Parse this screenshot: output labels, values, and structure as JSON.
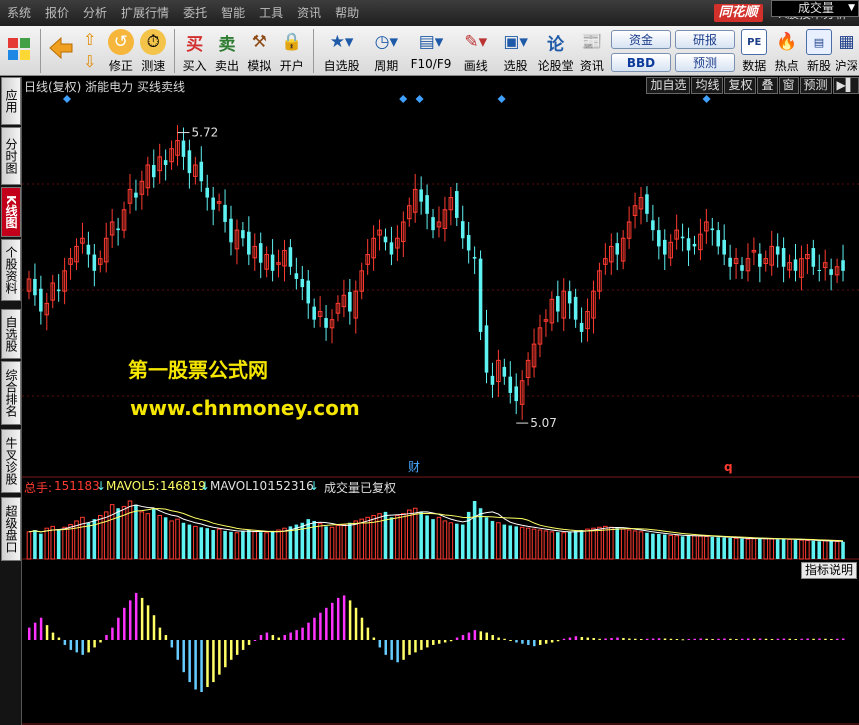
{
  "menu": [
    "系统",
    "报价",
    "分析",
    "扩展行情",
    "委托",
    "智能",
    "工具",
    "资讯",
    "帮助"
  ],
  "brand": {
    "logo": "同花顺",
    "title": "- A股技术分析"
  },
  "toolbar": {
    "modify": "修正",
    "test": "测速",
    "buy": "买入",
    "sell": "卖出",
    "simulate": "模拟",
    "open": "开户",
    "watchlist": "自选股",
    "period": "周期",
    "f10": "F10/F9",
    "draw": "画线",
    "select": "选股",
    "forum": "论股堂",
    "news": "资讯",
    "fund": "资金",
    "research": "研报",
    "bbd": "BBD",
    "predict": "预测",
    "data": "数据",
    "hot": "热点",
    "newstock": "新股",
    "sh": "沪深"
  },
  "sidetabs": [
    {
      "label": "应用"
    },
    {
      "label": "分时图"
    },
    {
      "label": "K线图",
      "active": true
    },
    {
      "label": "个股资料"
    },
    {
      "label": "自选股"
    },
    {
      "label": "综合排名"
    },
    {
      "label": "牛叉诊股"
    },
    {
      "label": "超级盘口"
    }
  ],
  "chart_header": {
    "title": "日线(复权)  浙能电力  买线卖线",
    "buttons": [
      "加自选",
      "均线",
      "复权",
      "叠",
      "窗",
      "预测",
      "▶▌"
    ]
  },
  "price": {
    "high_label": "5.72",
    "low_label": "5.07",
    "marker_cai": "财",
    "marker_q": "q",
    "ymin": 4.95,
    "ymax": 5.8
  },
  "volume_header": {
    "total_label": "总手:",
    "total": "151183",
    "ma5_label": "MAVOL5:",
    "ma5": "146819",
    "ma10_label": "MAVOL10:",
    "ma10": "152316",
    "note": "成交量已复权",
    "dropdown": "成交量"
  },
  "explain_button": "指标说明",
  "watermark": {
    "line1": "第一股票公式网",
    "line2": "www.chnmoney.com"
  },
  "colors": {
    "up": "#ff3b30",
    "down": "#5ff2f2",
    "ma": "#ffffff",
    "macd_pos_strong": "#ff33ff",
    "macd_pos": "#ffff66",
    "macd_neg": "#66ccff",
    "macd_neg2": "#ffff66"
  },
  "chart_data": {
    "type": "candlestick",
    "closes": [
      5.38,
      5.34,
      5.3,
      5.32,
      5.37,
      5.35,
      5.4,
      5.43,
      5.46,
      5.48,
      5.44,
      5.4,
      5.43,
      5.48,
      5.52,
      5.5,
      5.55,
      5.6,
      5.58,
      5.62,
      5.66,
      5.63,
      5.68,
      5.66,
      5.7,
      5.72,
      5.68,
      5.64,
      5.66,
      5.62,
      5.58,
      5.55,
      5.57,
      5.52,
      5.47,
      5.5,
      5.48,
      5.44,
      5.46,
      5.42,
      5.44,
      5.4,
      5.42,
      5.45,
      5.41,
      5.38,
      5.36,
      5.32,
      5.28,
      5.3,
      5.26,
      5.28,
      5.32,
      5.34,
      5.3,
      5.35,
      5.4,
      5.44,
      5.48,
      5.5,
      5.47,
      5.44,
      5.48,
      5.52,
      5.56,
      5.6,
      5.57,
      5.54,
      5.5,
      5.52,
      5.55,
      5.58,
      5.53,
      5.48,
      5.45,
      5.43,
      5.25,
      5.15,
      5.12,
      5.18,
      5.14,
      5.1,
      5.08,
      5.13,
      5.18,
      5.22,
      5.26,
      5.28,
      5.33,
      5.3,
      5.35,
      5.32,
      5.28,
      5.25,
      5.3,
      5.35,
      5.4,
      5.43,
      5.46,
      5.44,
      5.48,
      5.52,
      5.56,
      5.58,
      5.54,
      5.5,
      5.46,
      5.44,
      5.47,
      5.5,
      5.48,
      5.45,
      5.46,
      5.49,
      5.52,
      5.5,
      5.46,
      5.44,
      5.41,
      5.43,
      5.4,
      5.43,
      5.45,
      5.41,
      5.43,
      5.46,
      5.44,
      5.41,
      5.42,
      5.4,
      5.43,
      5.44,
      5.41,
      5.4,
      5.42,
      5.39,
      5.41,
      5.4
    ],
    "volumes": [
      150,
      160,
      140,
      170,
      180,
      165,
      175,
      190,
      210,
      230,
      200,
      220,
      240,
      260,
      300,
      280,
      290,
      320,
      300,
      260,
      250,
      280,
      240,
      230,
      210,
      220,
      200,
      190,
      180,
      175,
      170,
      160,
      165,
      155,
      150,
      145,
      155,
      160,
      150,
      148,
      145,
      150,
      160,
      170,
      180,
      190,
      200,
      220,
      210,
      195,
      180,
      175,
      185,
      190,
      200,
      210,
      220,
      230,
      240,
      250,
      260,
      230,
      240,
      250,
      270,
      280,
      260,
      240,
      220,
      230,
      210,
      200,
      195,
      190,
      260,
      320,
      280,
      230,
      210,
      200,
      190,
      185,
      180,
      175,
      170,
      165,
      160,
      155,
      150,
      148,
      145,
      150,
      155,
      160,
      165,
      170,
      175,
      180,
      175,
      170,
      165,
      160,
      155,
      150,
      145,
      140,
      138,
      135,
      130,
      128,
      125,
      130,
      128,
      126,
      124,
      122,
      120,
      118,
      116,
      114,
      112,
      110,
      112,
      114,
      112,
      110,
      108,
      110,
      108,
      106,
      104,
      102,
      100,
      98,
      100,
      98,
      96,
      95
    ],
    "macd": [
      0.5,
      0.7,
      0.9,
      0.6,
      0.3,
      0.1,
      -0.2,
      -0.4,
      -0.5,
      -0.6,
      -0.5,
      -0.3,
      -0.1,
      0.2,
      0.5,
      0.9,
      1.3,
      1.6,
      1.9,
      1.7,
      1.4,
      1.0,
      0.5,
      0.2,
      -0.3,
      -0.8,
      -1.3,
      -1.7,
      -2.0,
      -2.1,
      -1.9,
      -1.7,
      -1.4,
      -1.1,
      -0.8,
      -0.6,
      -0.4,
      -0.2,
      0.0,
      0.2,
      0.3,
      0.2,
      0.1,
      0.2,
      0.3,
      0.4,
      0.5,
      0.7,
      0.9,
      1.1,
      1.3,
      1.5,
      1.7,
      1.8,
      1.6,
      1.3,
      0.9,
      0.5,
      0.1,
      -0.3,
      -0.6,
      -0.8,
      -0.9,
      -0.8,
      -0.6,
      -0.5,
      -0.4,
      -0.3,
      -0.2,
      -0.15,
      -0.1,
      -0.05,
      0.1,
      0.2,
      0.3,
      0.4,
      0.35,
      0.3,
      0.2,
      0.1,
      0.05,
      0.0,
      -0.1,
      -0.15,
      -0.2,
      -0.25,
      -0.2,
      -0.15,
      -0.1,
      -0.05,
      0.05,
      0.1,
      0.15,
      0.12,
      0.1,
      0.08,
      0.05,
      0.06,
      0.08,
      0.1,
      0.08,
      0.06,
      0.05,
      0.04,
      0.05,
      0.06,
      0.07,
      0.06,
      0.05,
      0.04,
      0.03,
      0.04,
      0.05,
      0.06,
      0.05,
      0.04,
      0.05,
      0.06,
      0.05,
      0.04,
      0.05,
      0.06,
      0.05,
      0.06,
      0.05,
      0.04,
      0.05,
      0.06,
      0.05,
      0.04,
      0.05,
      0.06,
      0.05,
      0.06,
      0.05,
      0.04,
      0.05,
      0.06
    ]
  }
}
